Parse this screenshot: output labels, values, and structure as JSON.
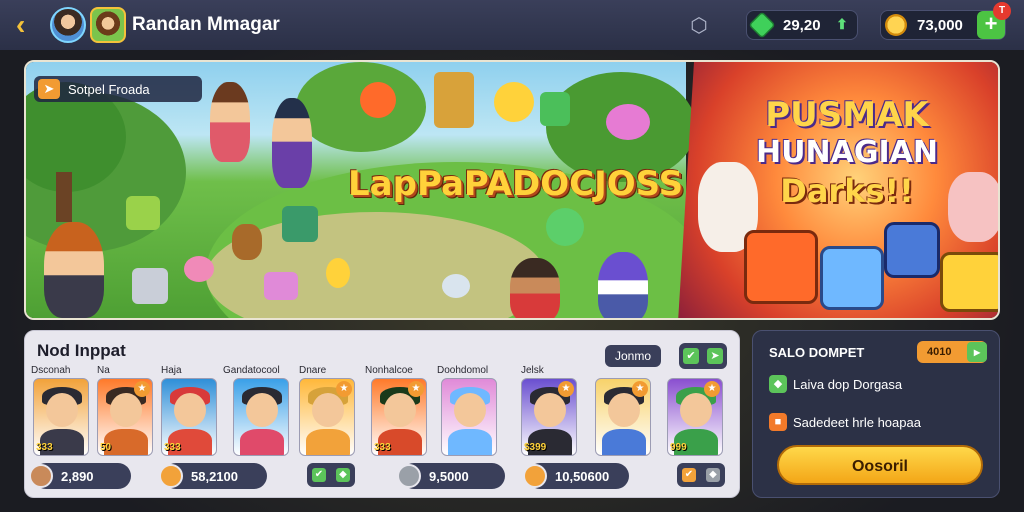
{
  "header": {
    "username": "Randan Mmagar",
    "gems": "29,20",
    "coins": "73,000",
    "notification_badge": "T",
    "icons": [
      "back-icon",
      "network-icon",
      "gem-icon",
      "coin-icon",
      "add-icon"
    ]
  },
  "banner": {
    "promo_label": "Sotpel Froada",
    "game_logo": "LapPaPADOCJOSS",
    "event_title_line1": "PUSMAK",
    "event_title_line2": "HUNAGIAN",
    "event_title_line3": "Darks!!"
  },
  "items_panel": {
    "title": "Nod Inppat",
    "filter_label": "Jonmo",
    "cards": [
      {
        "label": "Dsconah",
        "price": "333",
        "color": "#f2a23a"
      },
      {
        "label": "Na",
        "price": "50",
        "color": "#ff7a2a"
      },
      {
        "label": "Haja",
        "price": "333",
        "color": "#2f8fd8"
      },
      {
        "label": "Gandatocool",
        "price": "",
        "color": "#3aa0e8"
      },
      {
        "label": "Dnare",
        "price": "",
        "color": "#ffb83a"
      },
      {
        "label": "Nonhalcoe",
        "price": "333",
        "color": "#ff7a2a"
      },
      {
        "label": "Doohdomol",
        "price": "",
        "color": "#e08ad8"
      },
      {
        "label": "Jelsk",
        "price": "$399",
        "color": "#6a4fd0"
      },
      {
        "label": "",
        "price": "",
        "color": "#f8d26a"
      },
      {
        "label": "",
        "price": "999",
        "color": "#8a4fd0"
      }
    ],
    "prices": [
      "2,890",
      "58,2100",
      "9,5000",
      "10,50600"
    ]
  },
  "wallet": {
    "title": "SALO DOMPET",
    "badge_value": "4010",
    "row1": "Laiva dop Dorgasa",
    "row2": "Sadedeet hrle hoapaa",
    "button": "Oosoril"
  }
}
